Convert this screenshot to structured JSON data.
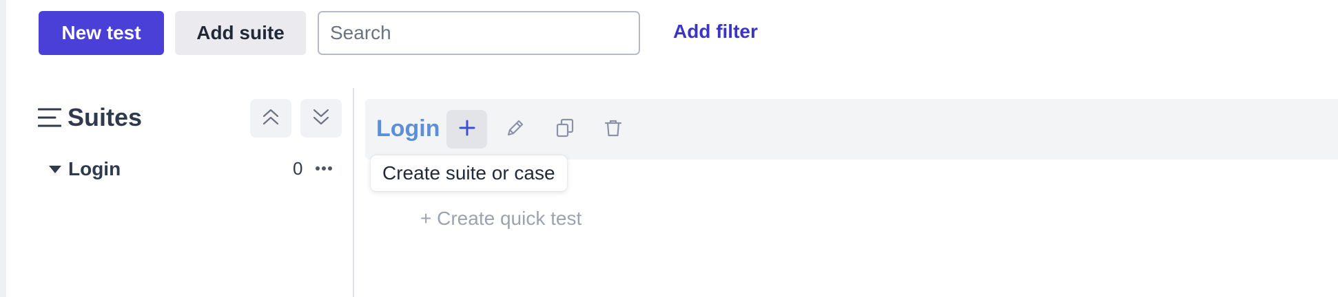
{
  "toolbar": {
    "new_test_label": "New test",
    "add_suite_label": "Add suite",
    "search_placeholder": "Search",
    "search_value": "",
    "add_filter_label": "Add filter"
  },
  "sidebar": {
    "title": "Suites",
    "items": [
      {
        "label": "Login",
        "count": "0"
      }
    ]
  },
  "suite_panel": {
    "name": "Login",
    "tooltip": "Create suite or case",
    "quick_test_label": "+ Create quick test"
  },
  "colors": {
    "primary": "#4a3fd6",
    "link": "#3b35c7",
    "suite_name": "#5b8fd8",
    "muted": "#9ca3af"
  },
  "icons": {
    "menu": "hamburger-menu-icon",
    "collapse": "chevrons-up-icon",
    "expand": "chevrons-down-icon",
    "caret": "caret-down-icon",
    "more": "ellipsis-icon",
    "plus": "plus-icon",
    "edit": "pencil-icon",
    "copy": "copy-icon",
    "delete": "trash-icon"
  }
}
